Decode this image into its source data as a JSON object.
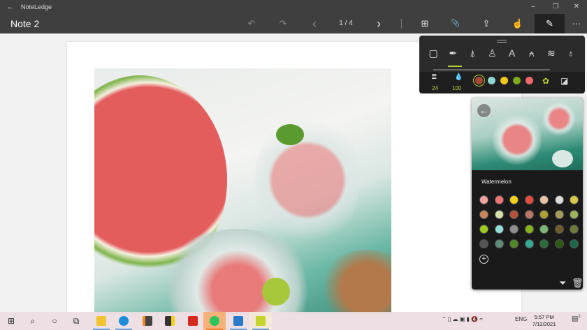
{
  "window": {
    "app_name": "NoteLedge",
    "back": "←",
    "minimize": "–",
    "restore": "❐",
    "close": "✕"
  },
  "toolbar": {
    "note_title": "Note 2",
    "undo": "↶",
    "redo": "↷",
    "prev": "‹",
    "page_indicator": "1 / 4",
    "next": "›",
    "grid": "⊞",
    "attach": "📎",
    "share": "⇪",
    "touch": "☝",
    "pen": "✎",
    "more": "···"
  },
  "pen_panel": {
    "tools": [
      {
        "icon": "eraser-icon",
        "g": "▢"
      },
      {
        "icon": "fountain-pen-icon",
        "g": "✒"
      },
      {
        "icon": "fine-pen-icon",
        "g": "⍋"
      },
      {
        "icon": "marker-icon",
        "g": "♙"
      },
      {
        "icon": "pencil-icon",
        "g": "A"
      },
      {
        "icon": "airbrush-icon",
        "g": "⍲"
      },
      {
        "icon": "texture-brush-icon",
        "g": "≋"
      },
      {
        "icon": "bulb-icon",
        "g": "♁"
      }
    ],
    "selected_tool": "fountain-pen",
    "size": "24",
    "opacity": "100",
    "colors": [
      "#a9473a",
      "#8fd6d4",
      "#f2c81b",
      "#7fab1d",
      "#ee6b6a"
    ],
    "selected_color": "#a9473a",
    "accent": "#b5d334"
  },
  "palette": {
    "name": "Watermelon",
    "back": "←",
    "add": "+",
    "swatches": [
      "#f4a3a3",
      "#f07575",
      "#f7d21a",
      "#ea4a3e",
      "#e8c3a6",
      "#dcdcdc",
      "#d8c84c",
      "#c9885a",
      "#d5e0ad",
      "#b5533c",
      "#b87564",
      "#ada130",
      "#a69c5a",
      "#9cb45b",
      "#9ccd1c",
      "#8fdfd8",
      "#8e8e8e",
      "#87b41a",
      "#7fb874",
      "#6f5b2a",
      "#6e7a3a",
      "#555555",
      "#5d8c7a",
      "#4f8a26",
      "#34a891",
      "#2b6c3c",
      "#2d5a16",
      "#1d6a48"
    ]
  },
  "taskbar": {
    "time": "5:57 PM",
    "date": "7/12/2021",
    "lang": "ENG",
    "start": "⊞",
    "search": "⌕",
    "cortana": "○",
    "taskview": "⧉",
    "notification_count": "1"
  }
}
